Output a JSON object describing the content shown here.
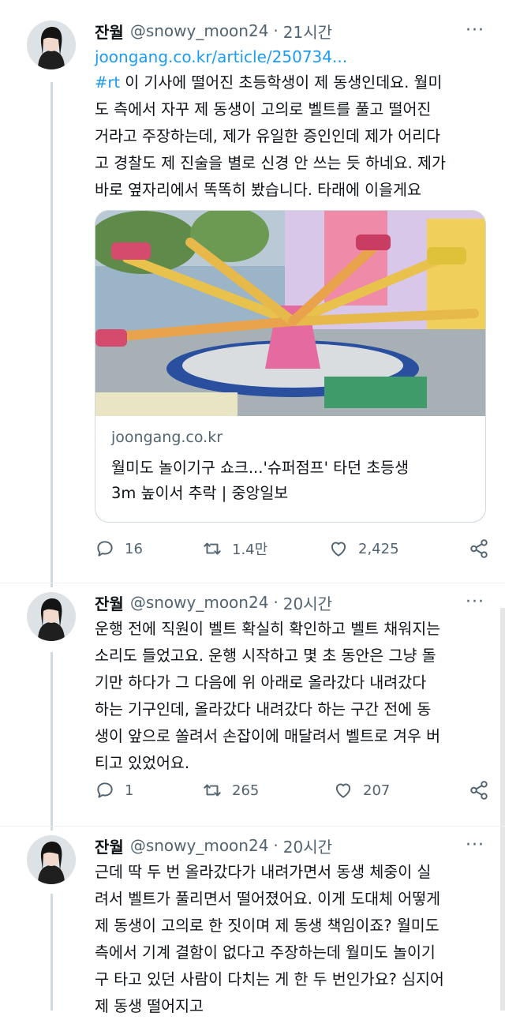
{
  "tweets": [
    {
      "name": "잔월",
      "handle": "@snowy_moon24",
      "dot": "·",
      "time": "21시간",
      "more": "···",
      "link": "joongang.co.kr/article/250734...",
      "hashtag": "#rt",
      "lines": [
        " 이 기사에 떨어진 초등학생이 제 동생인데요. 월미",
        "도 측에서 자꾸 제 동생이 고의로 벨트를 풀고 떨어진",
        "거라고 주장하는데, 제가 유일한 증인인데 제가 어리다",
        "고 경찰도 제 진술을 별로 신경 안 쓰는 듯 하네요. 제가",
        "바로 옆자리에서 똑똑히 봤습니다. 타래에 이을게요"
      ],
      "card": {
        "domain": "joongang.co.kr",
        "title_lines": [
          "월미도 놀이기구 쇼크...'슈퍼점프' 타던 초등생",
          "3m 높이서 추락 | 중앙일보"
        ]
      },
      "replies": "16",
      "retweets": "1.4만",
      "likes": "2,425"
    },
    {
      "name": "잔월",
      "handle": "@snowy_moon24",
      "dot": "·",
      "time": "20시간",
      "more": "···",
      "lines": [
        "운행 전에 직원이 벨트 확실히 확인하고 벨트 채워지는",
        "소리도 들었고요. 운행 시작하고 몇 초 동안은 그냥 돌",
        "기만 하다가 그 다음에 위 아래로 올라갔다 내려갔다",
        "하는 기구인데, 올라갔다 내려갔다 하는 구간 전에 동",
        "생이 앞으로 쏠려서 손잡이에 매달려서 벨트로 겨우 버",
        "티고 있었어요."
      ],
      "replies": "1",
      "retweets": "265",
      "likes": "207"
    },
    {
      "name": "잔월",
      "handle": "@snowy_moon24",
      "dot": "·",
      "time": "20시간",
      "more": "···",
      "lines": [
        "근데 딱 두 번 올라갔다가 내려가면서 동생 체중이 실",
        "려서 벨트가 풀리면서 떨어졌어요. 이게 도대체 어떻게",
        "제 동생이 고의로 한 짓이며 제 동생 책임이죠? 월미도",
        "측에서 기계 결함이 없다고 주장하는데 월미도 놀이기",
        "구 타고 있던 사람이 다치는 게 한 두 번인가요? 심지어",
        "제 동생 떨어지고"
      ]
    }
  ],
  "colors": {
    "accent": "#1d9bf0",
    "text": "#0f1419",
    "secondary": "#536471",
    "line": "#cfd9de"
  }
}
